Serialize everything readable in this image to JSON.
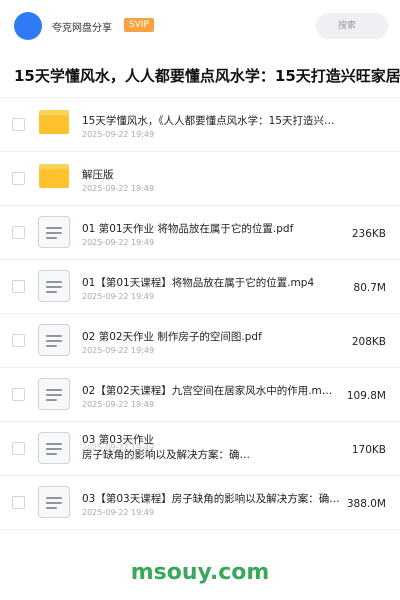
{
  "header": {
    "share_name": "夸克网盘分享",
    "badge": "SVIP",
    "search_placeholder": "搜索"
  },
  "page_title": "15天学懂风水，人人都要懂点风水学：15天打造兴旺家居，",
  "files": [
    {
      "type": "folder",
      "name": "15天学懂风水，《人人都要懂点风水学：15天打造兴…",
      "date": "2025-09-22 19:49",
      "size": ""
    },
    {
      "type": "folder",
      "name": "解压版",
      "date": "2025-09-22 19:49",
      "size": ""
    },
    {
      "type": "file",
      "name": "01 第01天作业 将物品放在属于它的位置.pdf",
      "date": "2025-09-22 19:49",
      "size": "236KB"
    },
    {
      "type": "file",
      "name": "01【第01天课程】将物品放在属于它的位置.mp4",
      "date": "2025-09-22 19:49",
      "size": "80.7M"
    },
    {
      "type": "file",
      "name": "02 第02天作业 制作房子的空间图.pdf",
      "date": "2025-09-22 19:49",
      "size": "208KB"
    },
    {
      "type": "file",
      "name": "02【第02天课程】九宫空间在居家风水中的作用.m…",
      "date": "2025-09-22 19:49",
      "size": "109.8M"
    },
    {
      "type": "file",
      "name": "03 第03天作业",
      "name2": "房子缺角的影响以及解决方案：确…",
      "date": "2025-09-22 19:49",
      "size": "170KB"
    },
    {
      "type": "file",
      "name": "03【第03天课程】房子缺角的影响以及解决方案：确…",
      "date": "2025-09-22 19:49",
      "size": "388.0M"
    }
  ],
  "footer": {
    "watermark": "msouy.com"
  },
  "colors": {
    "accent": "#2f7bf5",
    "svip": "#f5a340",
    "folder": "#fdc22d",
    "watermark": "#3aa85a"
  }
}
